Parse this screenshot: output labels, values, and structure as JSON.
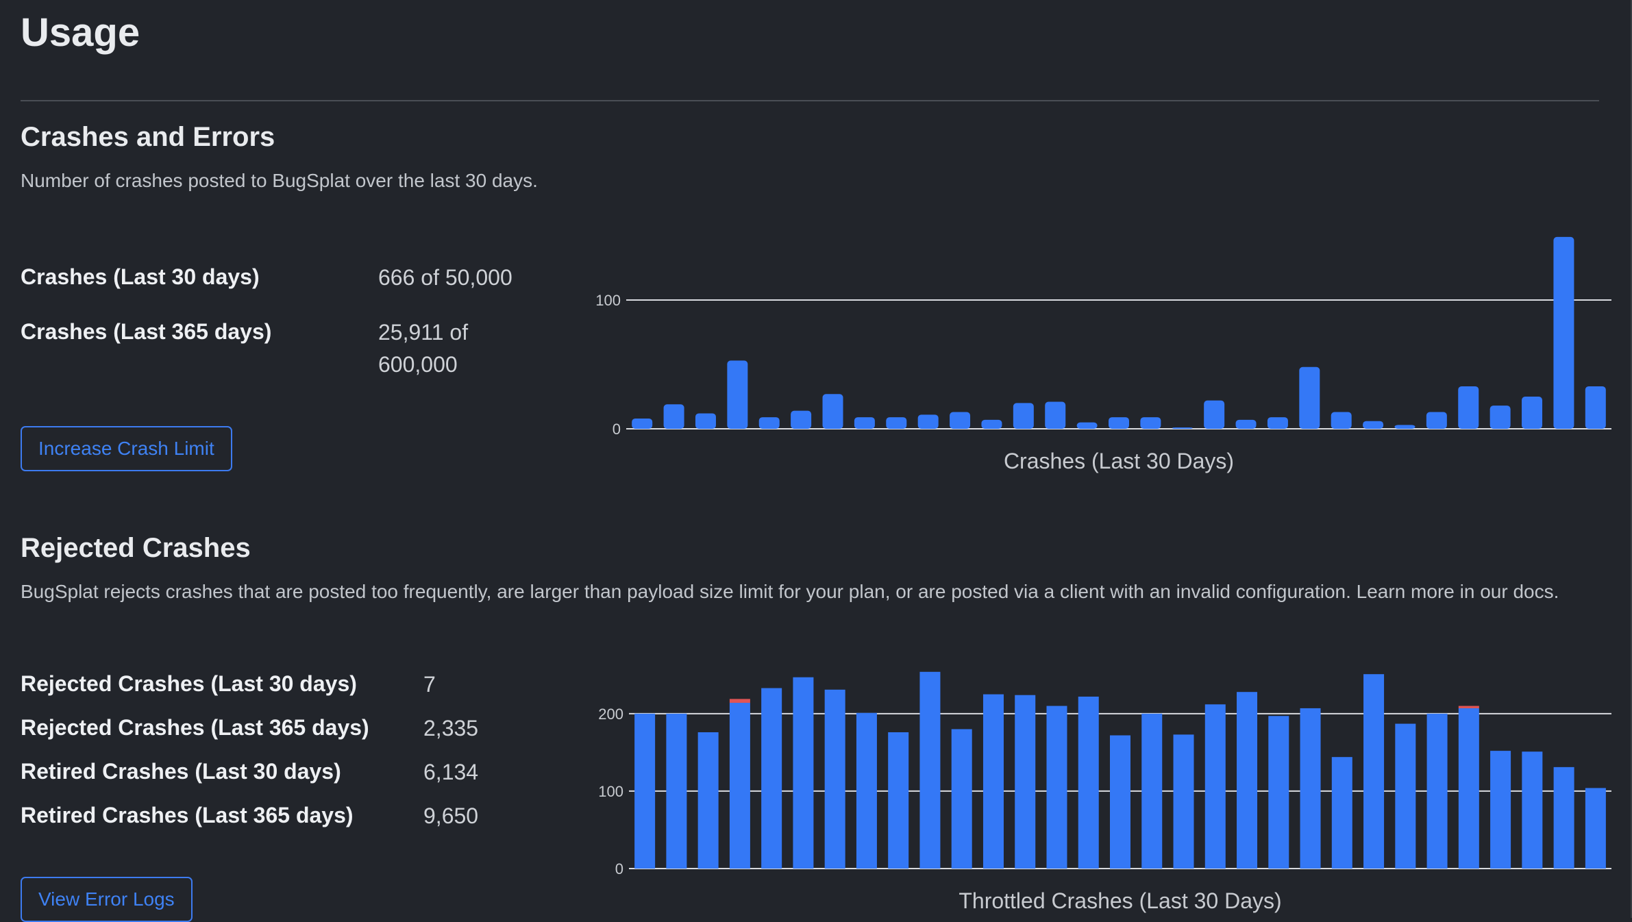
{
  "page": {
    "title": "Usage"
  },
  "crashes_section": {
    "title": "Crashes and Errors",
    "description": "Number of crashes posted to BugSplat over the last 30 days.",
    "stats": [
      {
        "label": "Crashes (Last 30 days)",
        "value": "666 of 50,000"
      },
      {
        "label": "Crashes (Last 365 days)",
        "value": "25,911 of 600,000"
      }
    ],
    "button_label": "Increase Crash Limit"
  },
  "rejected_section": {
    "title": "Rejected Crashes",
    "description": "BugSplat rejects crashes that are posted too frequently, are larger than payload size limit for your plan, or are posted via a client with an invalid configuration. Learn more in our docs.",
    "stats": [
      {
        "label": "Rejected Crashes (Last 30 days)",
        "value": "7"
      },
      {
        "label": "Rejected Crashes (Last 365 days)",
        "value": "2,335"
      },
      {
        "label": "Retired Crashes (Last 30 days)",
        "value": "6,134"
      },
      {
        "label": "Retired Crashes (Last 365 days)",
        "value": "9,650"
      }
    ],
    "button_label": "View Error Logs"
  },
  "colors": {
    "bar": "#3478f6",
    "rejected": "#e05555",
    "gridline": "#d9dbe0"
  },
  "chart_data": [
    {
      "type": "bar",
      "title": "",
      "xlabel": "Crashes (Last 30 Days)",
      "ylabel": "",
      "ylim": [
        0,
        150
      ],
      "yticks": [
        0,
        100
      ],
      "grid": true,
      "series": [
        {
          "values": [
            8,
            19,
            12,
            53,
            9,
            14,
            27,
            9,
            9,
            11,
            13,
            7,
            20,
            21,
            5,
            9,
            9,
            1,
            22,
            7,
            9,
            48,
            13,
            6,
            3,
            13,
            33,
            18,
            25,
            149,
            33
          ]
        }
      ]
    },
    {
      "type": "bar",
      "title": "",
      "xlabel": "Throttled Crashes (Last 30 Days)",
      "ylabel": "",
      "ylim": [
        0,
        260
      ],
      "yticks": [
        0,
        100,
        200
      ],
      "grid": true,
      "stacked": true,
      "series": [
        {
          "values": [
            200,
            200,
            176,
            214,
            233,
            247,
            231,
            201,
            176,
            254,
            180,
            225,
            224,
            210,
            222,
            172,
            200,
            173,
            212,
            228,
            197,
            207,
            144,
            251,
            187,
            200,
            207,
            152,
            151,
            131,
            104
          ]
        },
        {
          "values": [
            0,
            0,
            0,
            5,
            0,
            0,
            0,
            0,
            0,
            0,
            0,
            0,
            0,
            0,
            0,
            0,
            0,
            0,
            0,
            0,
            0,
            0,
            0,
            0,
            0,
            0,
            3,
            0,
            0,
            0,
            0
          ]
        }
      ]
    }
  ]
}
